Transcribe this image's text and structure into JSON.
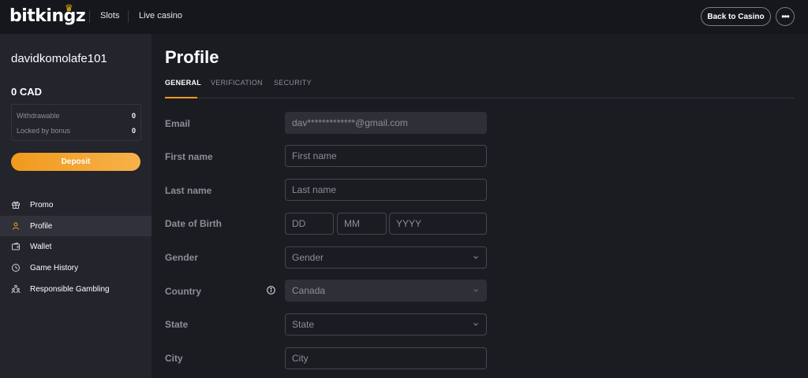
{
  "header": {
    "logo": "bitkingz",
    "nav": [
      "Slots",
      "Live casino"
    ],
    "back_button": "Back to Casino",
    "more_button": "•••"
  },
  "sidebar": {
    "username": "davidkomolafe101",
    "balance": "0  CAD",
    "withdrawable_label": "Withdrawable",
    "withdrawable_value": "0",
    "locked_label": "Locked by bonus",
    "locked_value": "0",
    "deposit_button": "Deposit",
    "menu": [
      {
        "label": "Promo",
        "icon": "gift-icon"
      },
      {
        "label": "Profile",
        "icon": "user-icon",
        "active": true
      },
      {
        "label": "Wallet",
        "icon": "wallet-icon"
      },
      {
        "label": "Game History",
        "icon": "clock-icon"
      },
      {
        "label": "Responsible Gambling",
        "icon": "people-icon"
      }
    ]
  },
  "main": {
    "title": "Profile",
    "tabs": [
      "GENERAL",
      "VERIFICATION",
      "SECURITY"
    ],
    "active_tab": "GENERAL",
    "form": {
      "email": {
        "label": "Email",
        "value": "dav*************@gmail.com"
      },
      "first_name": {
        "label": "First name",
        "placeholder": "First name"
      },
      "last_name": {
        "label": "Last name",
        "placeholder": "Last name"
      },
      "dob": {
        "label": "Date of Birth",
        "dd": "DD",
        "mm": "MM",
        "yyyy": "YYYY"
      },
      "gender": {
        "label": "Gender",
        "value": "Gender"
      },
      "country": {
        "label": "Country",
        "value": "Canada"
      },
      "state": {
        "label": "State",
        "value": "State"
      },
      "city": {
        "label": "City",
        "placeholder": "City"
      }
    }
  },
  "colors": {
    "accent": "#f09a1d",
    "background": "#1b1c22",
    "sidebar": "#23242c",
    "topbar": "#16171c"
  }
}
